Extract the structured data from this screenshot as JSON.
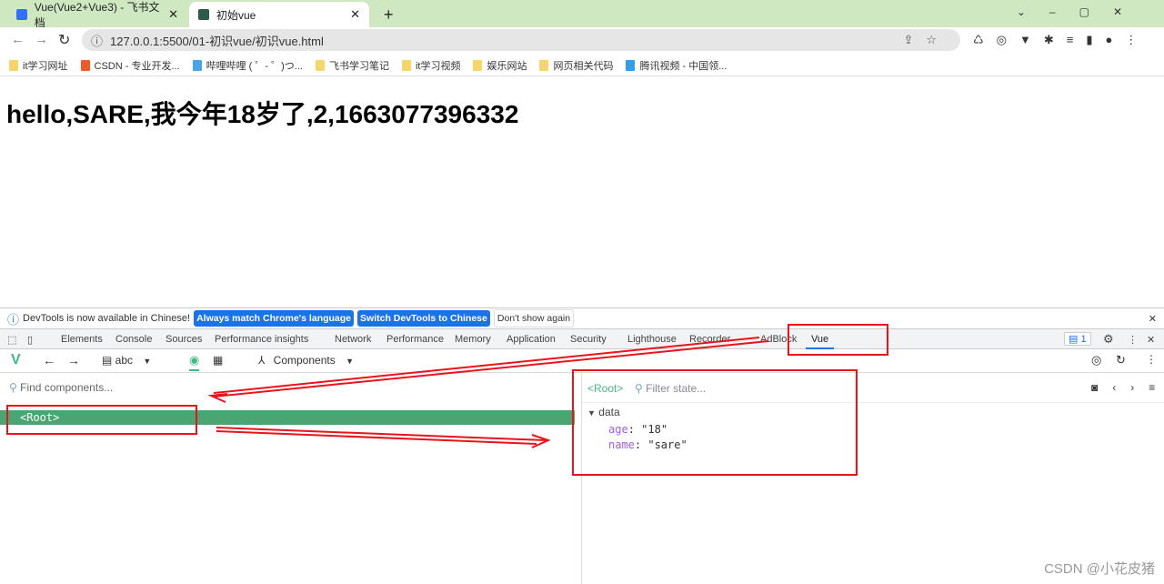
{
  "browser": {
    "tabs": [
      {
        "label": "Vue(Vue2+Vue3) - 飞书文档",
        "active": false
      },
      {
        "label": "初始vue",
        "active": true
      }
    ],
    "url": "127.0.0.1:5500/01-初识vue/初识vue.html",
    "bookmarks": [
      "it学习网址",
      "CSDN - 专业开发...",
      "哔哩哔哩 ( ゜- ゜)つ...",
      "飞书学习笔记",
      "it学习视频",
      "娱乐网站",
      "网页相关代码",
      "腾讯视频 - 中国领..."
    ]
  },
  "page": {
    "heading": "hello,SARE,我今年18岁了,2,1663077396332"
  },
  "devtools": {
    "infobar": {
      "message": "DevTools is now available in Chinese!",
      "btn_match": "Always match Chrome's language",
      "btn_switch": "Switch DevTools to Chinese",
      "btn_dont": "Don't show again"
    },
    "tabs": [
      "Elements",
      "Console",
      "Sources",
      "Performance insights",
      "Network",
      "Performance",
      "Memory",
      "Application",
      "Security",
      "Lighthouse",
      "Recorder",
      "AdBlock",
      "Vue"
    ],
    "active_tab": "Vue",
    "issues_count": "1",
    "vue": {
      "app_name": "abc",
      "view": "Components",
      "find_placeholder": "Find components...",
      "root_label": "<Root>",
      "filter_placeholder": "Filter state...",
      "section": "data",
      "state": [
        {
          "key": "age",
          "value": "\"18\""
        },
        {
          "key": "name",
          "value": "\"sare\""
        }
      ]
    }
  },
  "watermark": "CSDN @小花皮猪",
  "colors": {
    "accent": "#1a73e8",
    "vue_green": "#42b883",
    "selected_row": "#4aa572",
    "annotation": "#e8141c"
  }
}
